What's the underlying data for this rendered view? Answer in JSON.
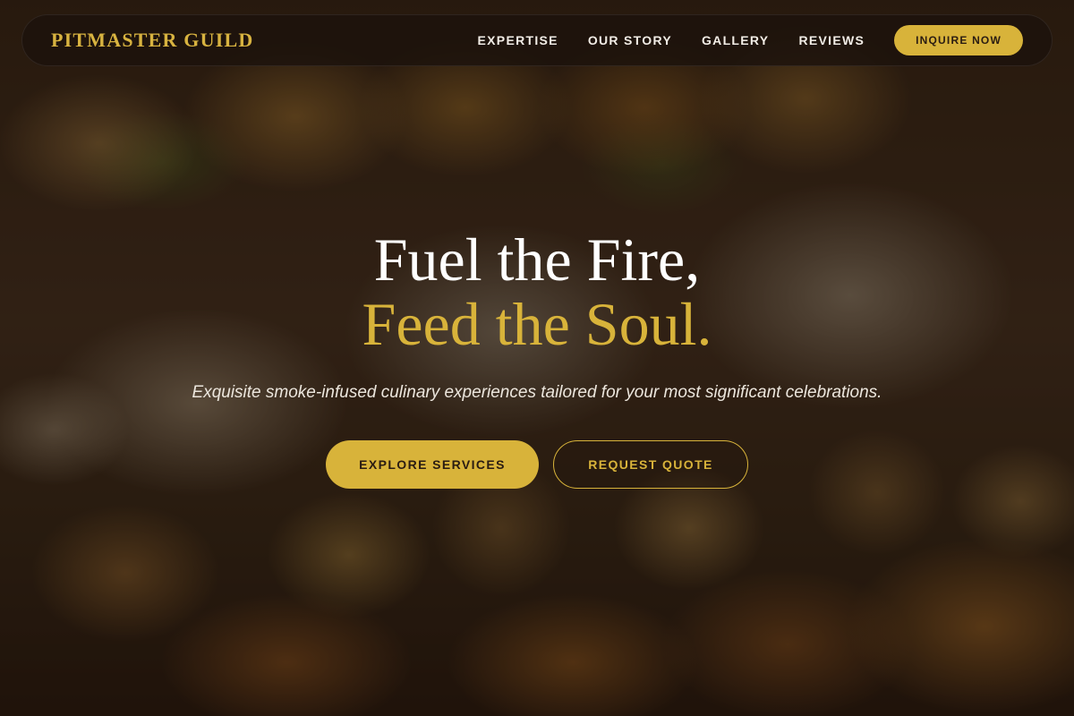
{
  "brand": {
    "name": "PITMASTER GUILD"
  },
  "nav": {
    "links": [
      {
        "label": "EXPERTISE"
      },
      {
        "label": "OUR STORY"
      },
      {
        "label": "GALLERY"
      },
      {
        "label": "REVIEWS"
      }
    ],
    "cta_label": "INQUIRE NOW"
  },
  "hero": {
    "title_line_1": "Fuel the Fire,",
    "title_line_2": "Feed the Soul.",
    "subtitle": "Exquisite smoke-infused culinary experiences tailored for your most significant celebrations.",
    "primary_button": "EXPLORE SERVICES",
    "secondary_button": "REQUEST QUOTE"
  },
  "colors": {
    "accent": "#d8b33a",
    "nav_background": "#1c120c",
    "title_white": "#ffffff"
  }
}
